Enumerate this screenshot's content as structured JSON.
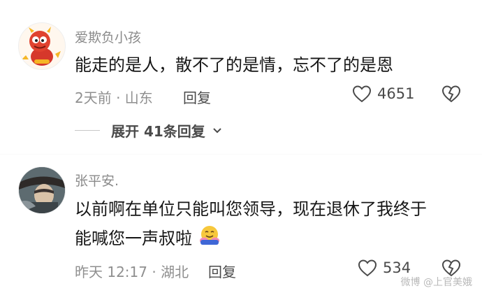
{
  "comments": [
    {
      "username": "爱欺负小孩",
      "text_lines": [
        "能走的是人，散不了的是情，忘不了的是恩"
      ],
      "time_location": "2天前 · 山东",
      "reply_label": "回复",
      "like_count": "4651",
      "expand_label": "展开 41条回复"
    },
    {
      "username": "张平安.",
      "text_lines": [
        "以前啊在单位只能叫您领导，现在退休了我终于",
        "能喊您一声叔啦"
      ],
      "time_location": "昨天 12:17 · 湖北",
      "reply_label": "回复",
      "like_count": "534"
    }
  ],
  "icons": {
    "like": "heart-outline-icon",
    "dislike": "broken-heart-icon",
    "expand": "chevron-down-icon",
    "emoji": "hugging-face-emoji"
  },
  "watermark": "微博 @上官美娥",
  "colors": {
    "text": "#161616",
    "secondary": "#8f8f8f",
    "username": "#8a8a8a"
  }
}
